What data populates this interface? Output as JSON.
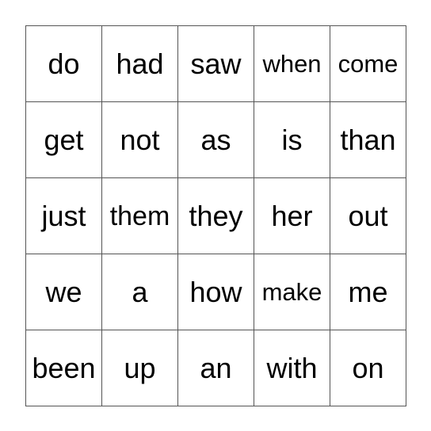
{
  "board": {
    "rows": [
      [
        "do",
        "had",
        "saw",
        "when",
        "come"
      ],
      [
        "get",
        "not",
        "as",
        "is",
        "than"
      ],
      [
        "just",
        "them",
        "they",
        "her",
        "out"
      ],
      [
        "we",
        "a",
        "how",
        "make",
        "me"
      ],
      [
        "been",
        "up",
        "an",
        "with",
        "on"
      ]
    ]
  }
}
